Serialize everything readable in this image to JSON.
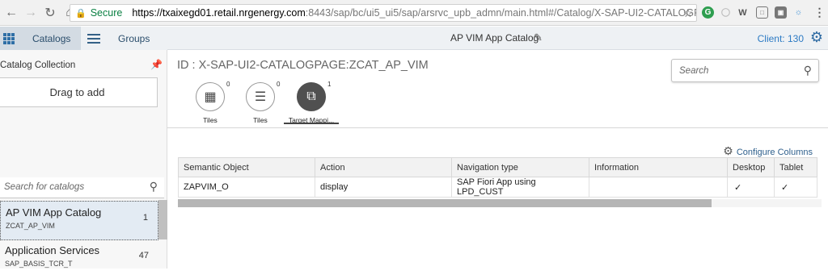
{
  "browser": {
    "secure_label": "Secure",
    "url_host": "https://txaixegd01.retail.nrgenergy.com",
    "url_rest": ":8443/sap/bc/ui5_ui5/sap/arsrvc_upb_admn/main.html#/Catalog/X-SAP-UI2-CATALOGPAGE:ZCAT_AP_VIM"
  },
  "shell": {
    "tab_catalogs": "Catalogs",
    "tab_groups": "Groups",
    "app_title": "AP VIM App Catalog",
    "client": "Client: 130"
  },
  "left": {
    "collection_title": "Catalog Collection",
    "drag_to_add": "Drag to add",
    "search_placeholder": "Search for catalogs",
    "items": [
      {
        "name": "AP VIM App Catalog",
        "id": "ZCAT_AP_VIM",
        "count": "1"
      },
      {
        "name": "Application Services",
        "id": "SAP_BASIS_TCR_T",
        "count": "47"
      }
    ]
  },
  "main": {
    "page_id": "ID : X-SAP-UI2-CATALOGPAGE:ZCAT_AP_VIM",
    "search_placeholder": "Search",
    "tabs": [
      {
        "label": "Tiles",
        "count": "0",
        "icon": "grid-icon"
      },
      {
        "label": "Tiles",
        "count": "0",
        "icon": "list-icon"
      },
      {
        "label": "Target Mappi...",
        "count": "1",
        "icon": "share-icon"
      }
    ],
    "configure_columns": "Configure Columns",
    "table": {
      "headers": [
        "Semantic Object",
        "Action",
        "Navigation type",
        "Information",
        "Desktop",
        "Tablet"
      ],
      "rows": [
        [
          "ZAPVIM_O",
          "display",
          "SAP Fiori App using LPD_CUST",
          "",
          "✓",
          "✓"
        ]
      ]
    }
  }
}
